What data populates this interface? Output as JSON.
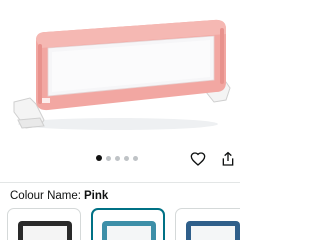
{
  "gallery": {
    "image_count": 5,
    "active_index": 0
  },
  "actions": {
    "wishlist_icon": "heart-outline-icon",
    "share_icon": "share-icon"
  },
  "variation": {
    "label": "Colour Name:",
    "selected_value": "Pink",
    "swatch_colors": [
      "#2a2a2a",
      "#3d8fa8",
      "#2f5f8a"
    ]
  },
  "colors": {
    "product_frame": "#f2a7a2",
    "mesh_panel": "#f6f6f8",
    "selected_border": "#007185"
  }
}
